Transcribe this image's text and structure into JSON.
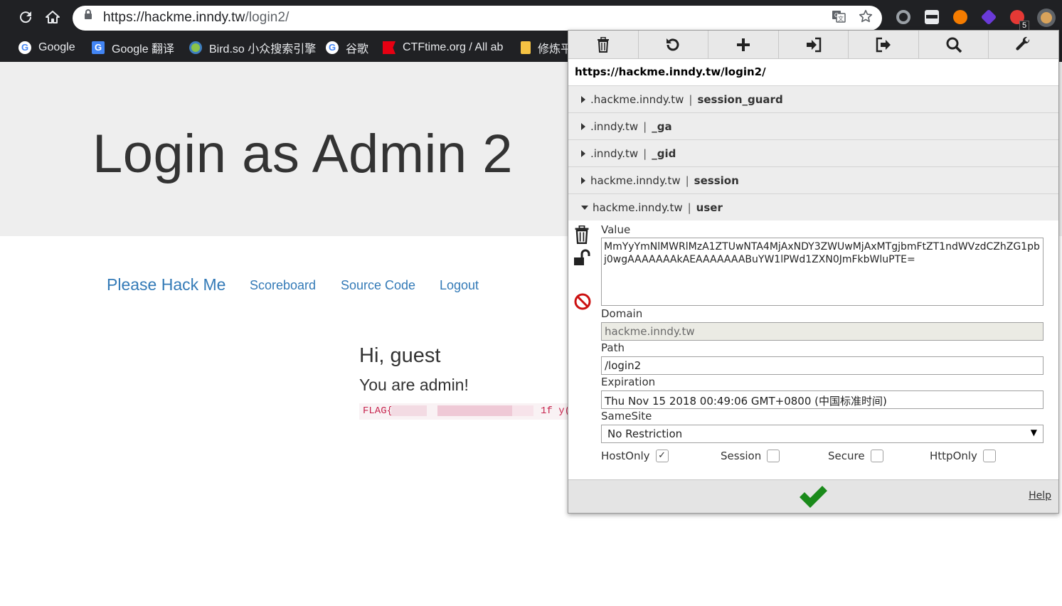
{
  "browser": {
    "url_host": "https://hackme.inndy.tw",
    "url_path": "/login2/",
    "extension_badge": "5",
    "bookmarks": [
      {
        "label": "Google",
        "icon": "google-icon"
      },
      {
        "label": "Google 翻译",
        "icon": "google-translate-icon"
      },
      {
        "label": "Bird.so 小众搜索引擎",
        "icon": "bird-icon"
      },
      {
        "label": "谷歌",
        "icon": "google-icon"
      },
      {
        "label": "CTFtime.org / All ab",
        "icon": "ctftime-flag-icon"
      },
      {
        "label": "修炼平",
        "icon": "bookmark-folder-icon"
      }
    ]
  },
  "page": {
    "title": "Login as Admin 2",
    "brand": "Please Hack Me",
    "nav": [
      "Scoreboard",
      "Source Code",
      "Logout"
    ],
    "greeting": "Hi, guest",
    "admin_text": "You are admin!",
    "flag_prefix": "FLAG{",
    "flag_tail": "1f y("
  },
  "cookie_editor": {
    "url": "https://hackme.inndy.tw/login2/",
    "cookies": [
      {
        "domain": ".hackme.inndy.tw",
        "name": "session_guard"
      },
      {
        "domain": ".inndy.tw",
        "name": "_ga"
      },
      {
        "domain": ".inndy.tw",
        "name": "_gid"
      },
      {
        "domain": "hackme.inndy.tw",
        "name": "session"
      },
      {
        "domain": "hackme.inndy.tw",
        "name": "user"
      }
    ],
    "separator": "|",
    "fields": {
      "value_label": "Value",
      "value": "MmYyYmNlMWRlMzA1ZTUwNTA4MjAxNDY3ZWUwMjAxMTgjbmFtZT1ndWVzdCZhZG1pbj0wgAAAAAAAkAEAAAAAAABuYW1lPWd1ZXN0JmFkbWluPTE=",
      "domain_label": "Domain",
      "domain": "hackme.inndy.tw",
      "path_label": "Path",
      "path": "/login2",
      "expiration_label": "Expiration",
      "expiration": "Thu Nov 15 2018 00:49:06 GMT+0800 (中国标准时间)",
      "samesite_label": "SameSite",
      "samesite": "No Restriction",
      "hostonly_label": "HostOnly",
      "session_label": "Session",
      "secure_label": "Secure",
      "httponly_label": "HttpOnly",
      "hostonly_checked": true,
      "session_checked": false,
      "secure_checked": false,
      "httponly_checked": false
    },
    "help_label": "Help"
  },
  "colors": {
    "chrome_dark": "#202124",
    "jumbotron_bg": "#eeeeee",
    "link_blue": "#337ab7",
    "flag_red": "#c7254e",
    "save_green": "#1a8a1a",
    "block_red": "#cc1111"
  }
}
